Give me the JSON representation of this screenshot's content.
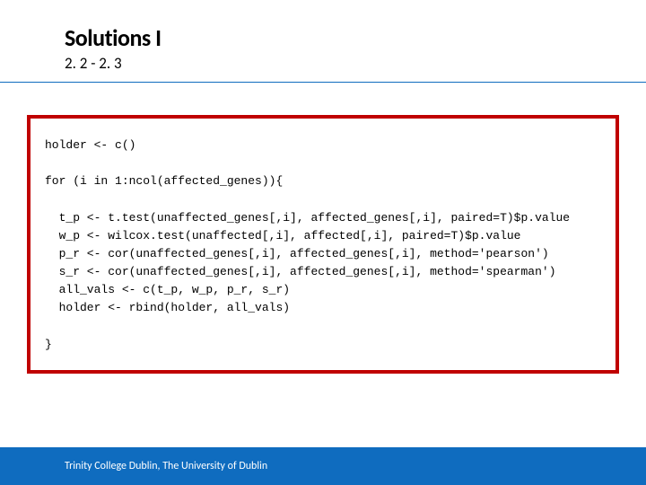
{
  "header": {
    "title": "Solutions I",
    "subtitle": "2. 2 - 2. 3"
  },
  "code": "holder <- c()\n\nfor (i in 1:ncol(affected_genes)){\n\n  t_p <- t.test(unaffected_genes[,i], affected_genes[,i], paired=T)$p.value\n  w_p <- wilcox.test(unaffected[,i], affected[,i], paired=T)$p.value\n  p_r <- cor(unaffected_genes[,i], affected_genes[,i], method='pearson')\n  s_r <- cor(unaffected_genes[,i], affected_genes[,i], method='spearman')\n  all_vals <- c(t_p, w_p, p_r, s_r)\n  holder <- rbind(holder, all_vals)\n\n}",
  "footer": {
    "text": "Trinity College Dublin, The University of Dublin"
  }
}
